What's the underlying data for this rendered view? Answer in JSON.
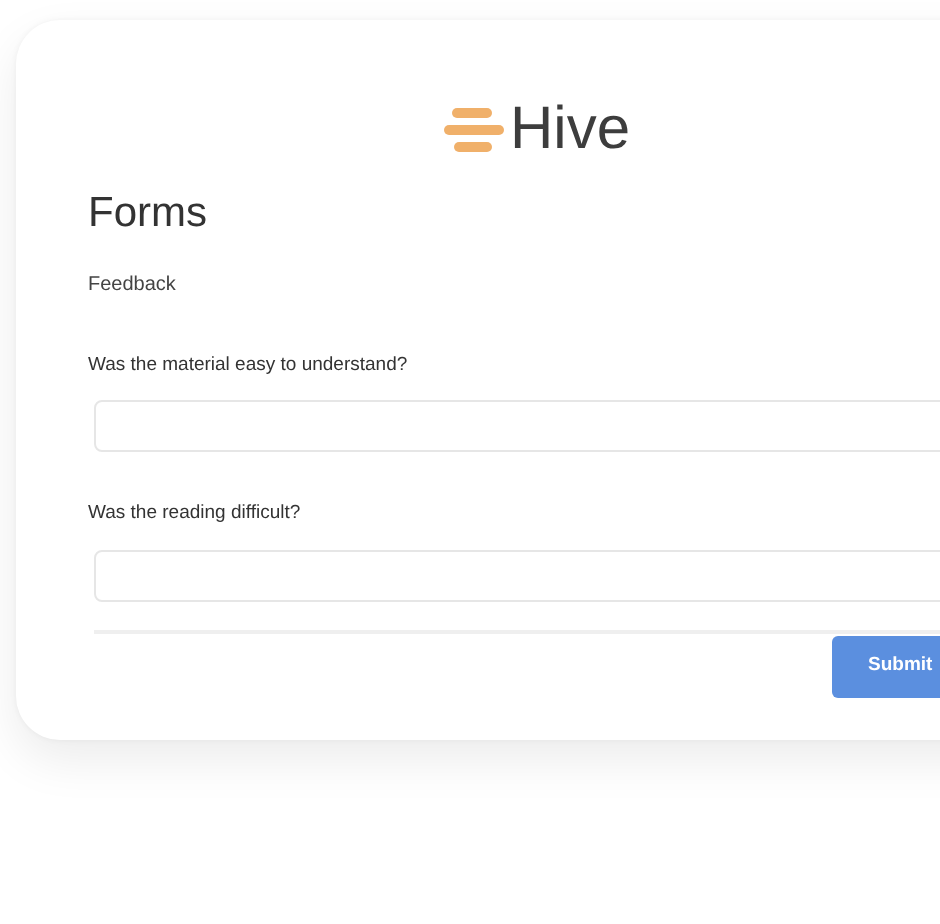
{
  "logo": {
    "name": "Hive"
  },
  "title": "Forms",
  "subtitle": "Feedback",
  "questions": [
    {
      "label": "Was the material easy to understand?"
    },
    {
      "label": "Was the reading difficult?"
    }
  ],
  "submit": "Submit"
}
